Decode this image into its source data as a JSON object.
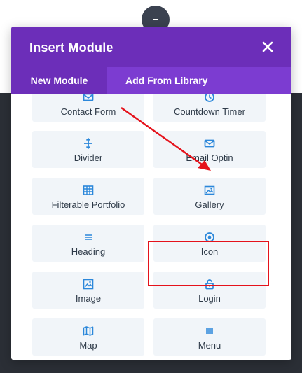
{
  "modal": {
    "title": "Insert Module",
    "close_icon": "close-icon",
    "tabs": [
      {
        "label": "New Module",
        "active": true
      },
      {
        "label": "Add From Library",
        "active": false
      }
    ]
  },
  "modules": [
    {
      "label": "Contact Form",
      "icon": "envelope-icon"
    },
    {
      "label": "Countdown Timer",
      "icon": "clock-icon"
    },
    {
      "label": "Divider",
      "icon": "divider-icon"
    },
    {
      "label": "Email Optin",
      "icon": "email-icon"
    },
    {
      "label": "Filterable Portfolio",
      "icon": "portfolio-grid-icon"
    },
    {
      "label": "Gallery",
      "icon": "gallery-icon"
    },
    {
      "label": "Heading",
      "icon": "heading-icon"
    },
    {
      "label": "Icon",
      "icon": "icon-circle-icon"
    },
    {
      "label": "Image",
      "icon": "image-icon"
    },
    {
      "label": "Login",
      "icon": "lock-icon"
    },
    {
      "label": "Map",
      "icon": "map-icon"
    },
    {
      "label": "Menu",
      "icon": "menu-icon"
    }
  ],
  "colors": {
    "header": "#6c2eb9",
    "tabs_bar": "#7c3cd1",
    "tile_bg": "#f1f5f9",
    "icon_blue": "#2b87da",
    "annotation_red": "#e5121b"
  },
  "annotation": {
    "highlighted_module": "Gallery"
  }
}
